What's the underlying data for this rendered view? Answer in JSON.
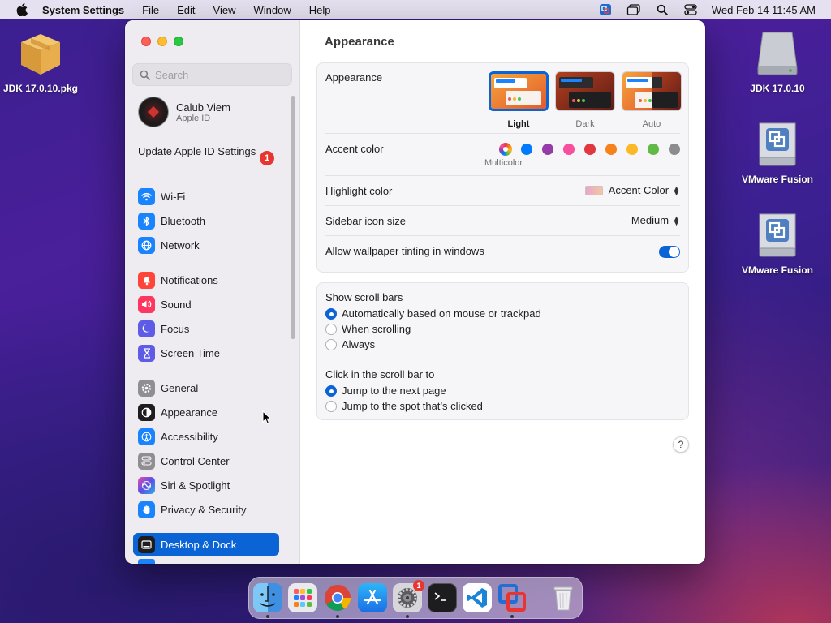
{
  "menubar": {
    "app_name": "System Settings",
    "menus": [
      "File",
      "Edit",
      "View",
      "Window",
      "Help"
    ],
    "clock": "Wed Feb 14  11:45 AM"
  },
  "desktop": {
    "pkg": "JDK 17.0.10.pkg",
    "disk": "JDK 17.0.10",
    "vm1": "VMware Fusion",
    "vm2": "VMware Fusion"
  },
  "sidebar": {
    "search_placeholder": "Search",
    "profile_name": "Calub Viem",
    "profile_sub": "Apple ID",
    "update_label": "Update Apple ID Settings",
    "update_badge": "1",
    "items": [
      {
        "label": "Wi-Fi",
        "color": "#1a84ff"
      },
      {
        "label": "Bluetooth",
        "color": "#1a84ff"
      },
      {
        "label": "Network",
        "color": "#1a84ff"
      },
      {
        "label": "Notifications",
        "color": "#ff453a"
      },
      {
        "label": "Sound",
        "color": "#ff375f"
      },
      {
        "label": "Focus",
        "color": "#5e5ce6"
      },
      {
        "label": "Screen Time",
        "color": "#5e5ce6"
      },
      {
        "label": "General",
        "color": "#8e8e93"
      },
      {
        "label": "Appearance",
        "color": "#1d1d1f"
      },
      {
        "label": "Accessibility",
        "color": "#1a84ff"
      },
      {
        "label": "Control Center",
        "color": "#8e8e93"
      },
      {
        "label": "Siri & Spotlight",
        "color": "#a34fd6"
      },
      {
        "label": "Privacy & Security",
        "color": "#1a84ff"
      },
      {
        "label": "Desktop & Dock",
        "color": "#1d1d1f"
      }
    ]
  },
  "main": {
    "title": "Appearance",
    "appearance": {
      "label": "Appearance",
      "options": [
        "Light",
        "Dark",
        "Auto"
      ],
      "selected": "Light"
    },
    "accent": {
      "label": "Accent color",
      "colors": [
        "#007aff",
        "#953ca8",
        "#f74f9e",
        "#e0383e",
        "#f7821b",
        "#fcb827",
        "#62ba46",
        "#8c8c8c"
      ],
      "multicolor_label": "Multicolor"
    },
    "highlight": {
      "label": "Highlight color",
      "value": "Accent Color"
    },
    "icon_size": {
      "label": "Sidebar icon size",
      "value": "Medium"
    },
    "tinting": {
      "label": "Allow wallpaper tinting in windows",
      "enabled": true
    },
    "scroll_bars": {
      "title": "Show scroll bars",
      "options": [
        "Automatically based on mouse or trackpad",
        "When scrolling",
        "Always"
      ],
      "selected": 0
    },
    "click_scroll": {
      "title": "Click in the scroll bar to",
      "options": [
        "Jump to the next page",
        "Jump to the spot that’s clicked"
      ],
      "selected": 0
    },
    "help_label": "?"
  },
  "dock": {
    "apps": [
      "Finder",
      "Launchpad",
      "Chrome",
      "App Store",
      "System Settings",
      "Terminal",
      "Visual Studio Code",
      "VMware Fusion",
      "Trash"
    ],
    "settings_badge": "1"
  }
}
